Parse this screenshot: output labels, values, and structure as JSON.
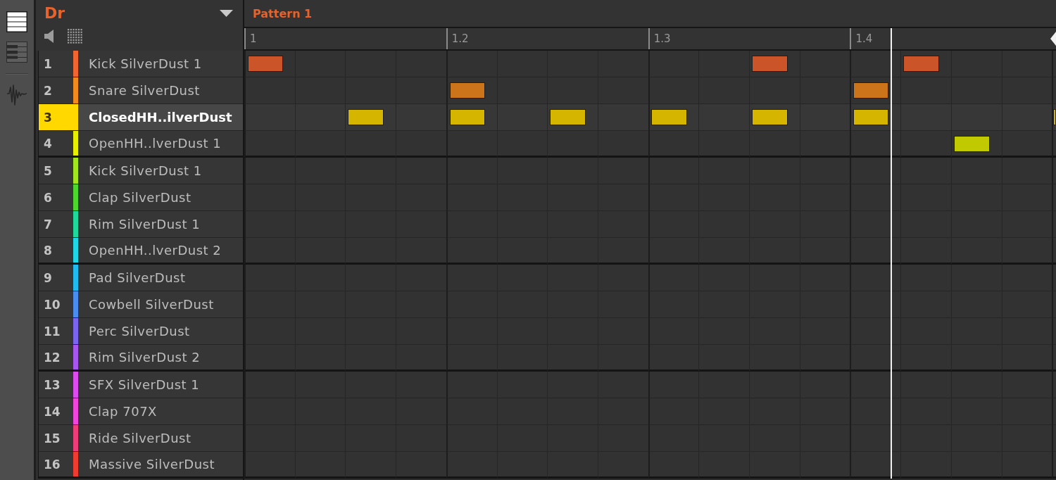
{
  "sidebar": {
    "view_buttons": [
      {
        "kind": "list",
        "selected": true
      },
      {
        "kind": "keyboard",
        "selected": false
      }
    ]
  },
  "group": {
    "name": "Dr"
  },
  "sounds": [
    {
      "number": "1",
      "name": "Kick SilverDust 1",
      "color": "#f26430",
      "selected": false,
      "steps": [
        true,
        false,
        false,
        false,
        false,
        false,
        false,
        false,
        false,
        false,
        true,
        false,
        false,
        true,
        false,
        false,
        false
      ]
    },
    {
      "number": "2",
      "name": "Snare SilverDust",
      "color": "#f28a1e",
      "selected": false,
      "steps": [
        false,
        false,
        false,
        false,
        true,
        false,
        false,
        false,
        false,
        false,
        false,
        false,
        true,
        false,
        false,
        false,
        false
      ]
    },
    {
      "number": "3",
      "name": "ClosedHH..ilverDust",
      "color": "#ffd800",
      "selected": true,
      "steps": [
        false,
        false,
        true,
        false,
        true,
        false,
        true,
        false,
        true,
        false,
        true,
        false,
        true,
        false,
        false,
        false,
        true
      ]
    },
    {
      "number": "4",
      "name": "OpenHH..lverDust 1",
      "color": "#e6f000",
      "selected": false,
      "steps": [
        false,
        false,
        false,
        false,
        false,
        false,
        false,
        false,
        false,
        false,
        false,
        false,
        false,
        false,
        true,
        false,
        false
      ]
    },
    {
      "number": "5",
      "name": "Kick SilverDust 1",
      "color": "#a2e61e",
      "selected": false,
      "steps": [
        false,
        false,
        false,
        false,
        false,
        false,
        false,
        false,
        false,
        false,
        false,
        false,
        false,
        false,
        false,
        false,
        false
      ]
    },
    {
      "number": "6",
      "name": "Clap SilverDust",
      "color": "#4cd82c",
      "selected": false,
      "steps": [
        false,
        false,
        false,
        false,
        false,
        false,
        false,
        false,
        false,
        false,
        false,
        false,
        false,
        false,
        false,
        false,
        false
      ]
    },
    {
      "number": "7",
      "name": "Rim SilverDust 1",
      "color": "#1ed89c",
      "selected": false,
      "steps": [
        false,
        false,
        false,
        false,
        false,
        false,
        false,
        false,
        false,
        false,
        false,
        false,
        false,
        false,
        false,
        false,
        false
      ]
    },
    {
      "number": "8",
      "name": "OpenHH..lverDust 2",
      "color": "#1ed8e8",
      "selected": false,
      "steps": [
        false,
        false,
        false,
        false,
        false,
        false,
        false,
        false,
        false,
        false,
        false,
        false,
        false,
        false,
        false,
        false,
        false
      ]
    },
    {
      "number": "9",
      "name": "Pad SilverDust",
      "color": "#1ebcf0",
      "selected": false,
      "steps": [
        false,
        false,
        false,
        false,
        false,
        false,
        false,
        false,
        false,
        false,
        false,
        false,
        false,
        false,
        false,
        false,
        false
      ]
    },
    {
      "number": "10",
      "name": "Cowbell SilverDust",
      "color": "#4a8cf0",
      "selected": false,
      "steps": [
        false,
        false,
        false,
        false,
        false,
        false,
        false,
        false,
        false,
        false,
        false,
        false,
        false,
        false,
        false,
        false,
        false
      ]
    },
    {
      "number": "11",
      "name": "Perc SilverDust",
      "color": "#7a64f0",
      "selected": false,
      "steps": [
        false,
        false,
        false,
        false,
        false,
        false,
        false,
        false,
        false,
        false,
        false,
        false,
        false,
        false,
        false,
        false,
        false
      ]
    },
    {
      "number": "12",
      "name": "Rim SilverDust 2",
      "color": "#a856f0",
      "selected": false,
      "steps": [
        false,
        false,
        false,
        false,
        false,
        false,
        false,
        false,
        false,
        false,
        false,
        false,
        false,
        false,
        false,
        false,
        false
      ]
    },
    {
      "number": "13",
      "name": "SFX SilverDust 1",
      "color": "#dc4af0",
      "selected": false,
      "steps": [
        false,
        false,
        false,
        false,
        false,
        false,
        false,
        false,
        false,
        false,
        false,
        false,
        false,
        false,
        false,
        false,
        false
      ]
    },
    {
      "number": "14",
      "name": "Clap 707X",
      "color": "#f044dc",
      "selected": false,
      "steps": [
        false,
        false,
        false,
        false,
        false,
        false,
        false,
        false,
        false,
        false,
        false,
        false,
        false,
        false,
        false,
        false,
        false
      ]
    },
    {
      "number": "15",
      "name": "Ride SilverDust",
      "color": "#f03c78",
      "selected": false,
      "steps": [
        false,
        false,
        false,
        false,
        false,
        false,
        false,
        false,
        false,
        false,
        false,
        false,
        false,
        false,
        false,
        false,
        false
      ]
    },
    {
      "number": "16",
      "name": "Massive SilverDust",
      "color": "#f03c30",
      "selected": false,
      "steps": [
        false,
        false,
        false,
        false,
        false,
        false,
        false,
        false,
        false,
        false,
        false,
        false,
        false,
        false,
        false,
        false,
        false
      ]
    }
  ],
  "pattern": {
    "name": "Pattern 1",
    "ruler": [
      "1",
      "1.2",
      "1.3",
      "1.4"
    ],
    "playhead": {
      "level": 0.8
    }
  }
}
